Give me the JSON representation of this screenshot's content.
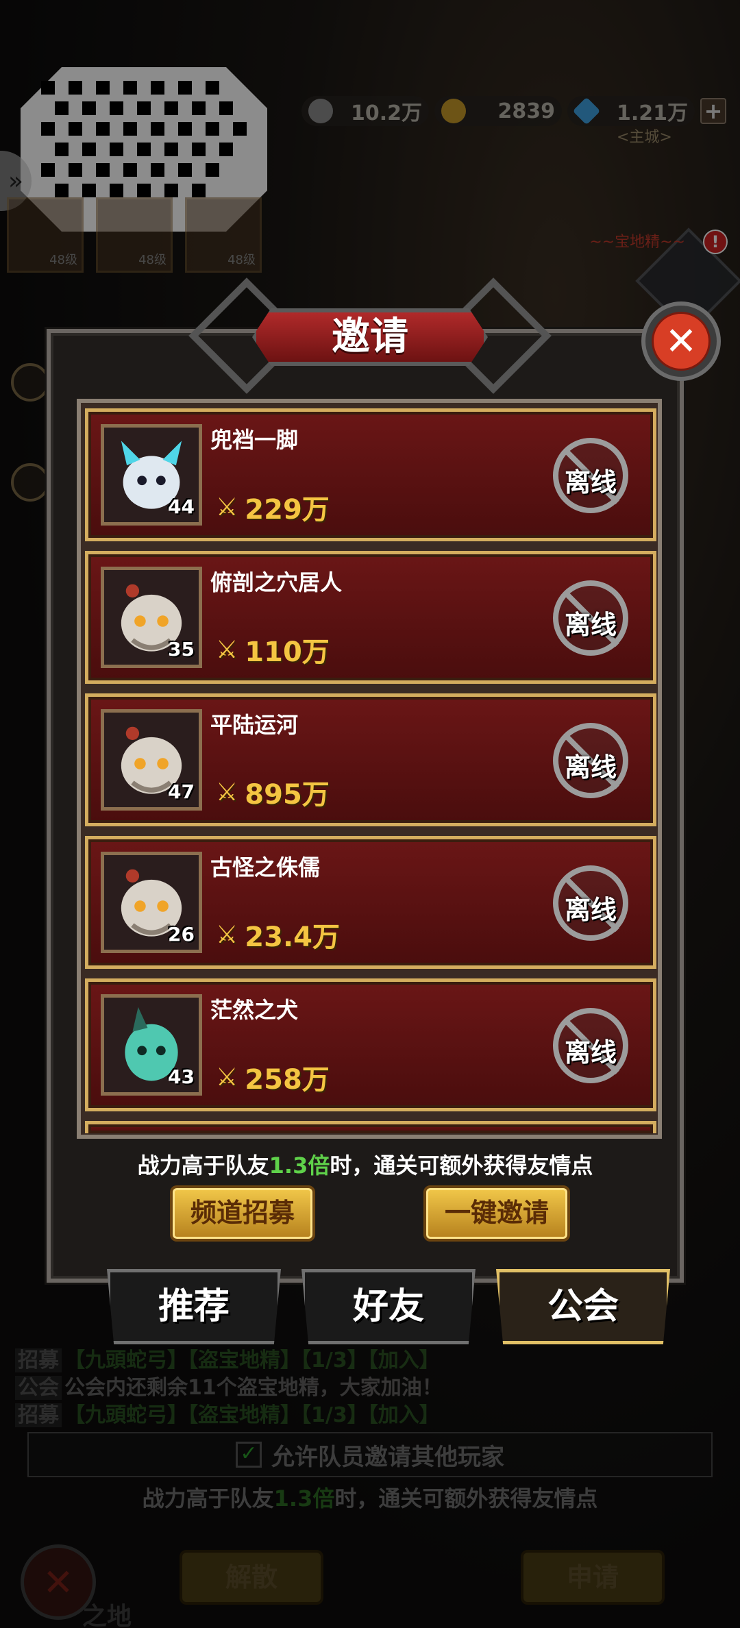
{
  "hud": {
    "resources": [
      {
        "icon": "silver-coin-icon",
        "value": "10.2万",
        "color": "#8a8a8a"
      },
      {
        "icon": "gold-coin-icon",
        "value": "2839",
        "color": "#c79a28"
      },
      {
        "icon": "diamond-icon",
        "value": "1.21万",
        "color": "#3fa0e0"
      }
    ],
    "plus": "+",
    "sub_label": "<主城>",
    "hero_levels": [
      "48级",
      "48级",
      "48级"
    ],
    "red_tag": "~~宝地精~~",
    "alert": "!"
  },
  "dialog": {
    "title": "邀请",
    "close": "✕",
    "players": [
      {
        "name": "兜裆一脚",
        "level": "44",
        "power": "229万",
        "status": "离线",
        "skin": "#dfe8f0",
        "accent": "#4fd6e8"
      },
      {
        "name": "俯剖之穴居人",
        "level": "35",
        "power": "110万",
        "status": "离线",
        "skin": "#d9d2c8",
        "accent": "#f0a428"
      },
      {
        "name": "平陆运河",
        "level": "47",
        "power": "895万",
        "status": "离线",
        "skin": "#d9d2c8",
        "accent": "#f0a428"
      },
      {
        "name": "古怪之侏儒",
        "level": "26",
        "power": "23.4万",
        "status": "离线",
        "skin": "#d9d2c8",
        "accent": "#f0a428"
      },
      {
        "name": "茫然之犬",
        "level": "43",
        "power": "258万",
        "status": "离线",
        "skin": "#4fc8b0",
        "accent": "#2a6a5c"
      }
    ],
    "tip_prefix": "战力高于队友",
    "tip_highlight": "1.3倍",
    "tip_suffix": "时，通关可额外获得友情点",
    "buttons": {
      "recruit": "频道招募",
      "invite_all": "一键邀请"
    },
    "tabs": [
      {
        "label": "推荐",
        "active": false
      },
      {
        "label": "好友",
        "active": false
      },
      {
        "label": "公会",
        "active": true
      }
    ]
  },
  "background": {
    "chat": [
      {
        "tag": "招募",
        "text": "【九頭蛇弓】【盗宝地精】【1/3】【加入】"
      },
      {
        "tag": "公会",
        "text": "公会内还剩余11个盗宝地精，大家加油！"
      },
      {
        "tag": "招募",
        "text": "【九頭蛇弓】【盗宝地精】【1/3】【加入】"
      }
    ],
    "allow_invite": "允许队员邀请其他玩家",
    "allow_check": "✓",
    "tip_prefix": "战力高于队友",
    "tip_highlight": "1.3倍",
    "tip_suffix": "时，通关可额外获得友情点",
    "disband": "解散",
    "apply": "申请",
    "left_label": "之地",
    "close": "✕"
  }
}
